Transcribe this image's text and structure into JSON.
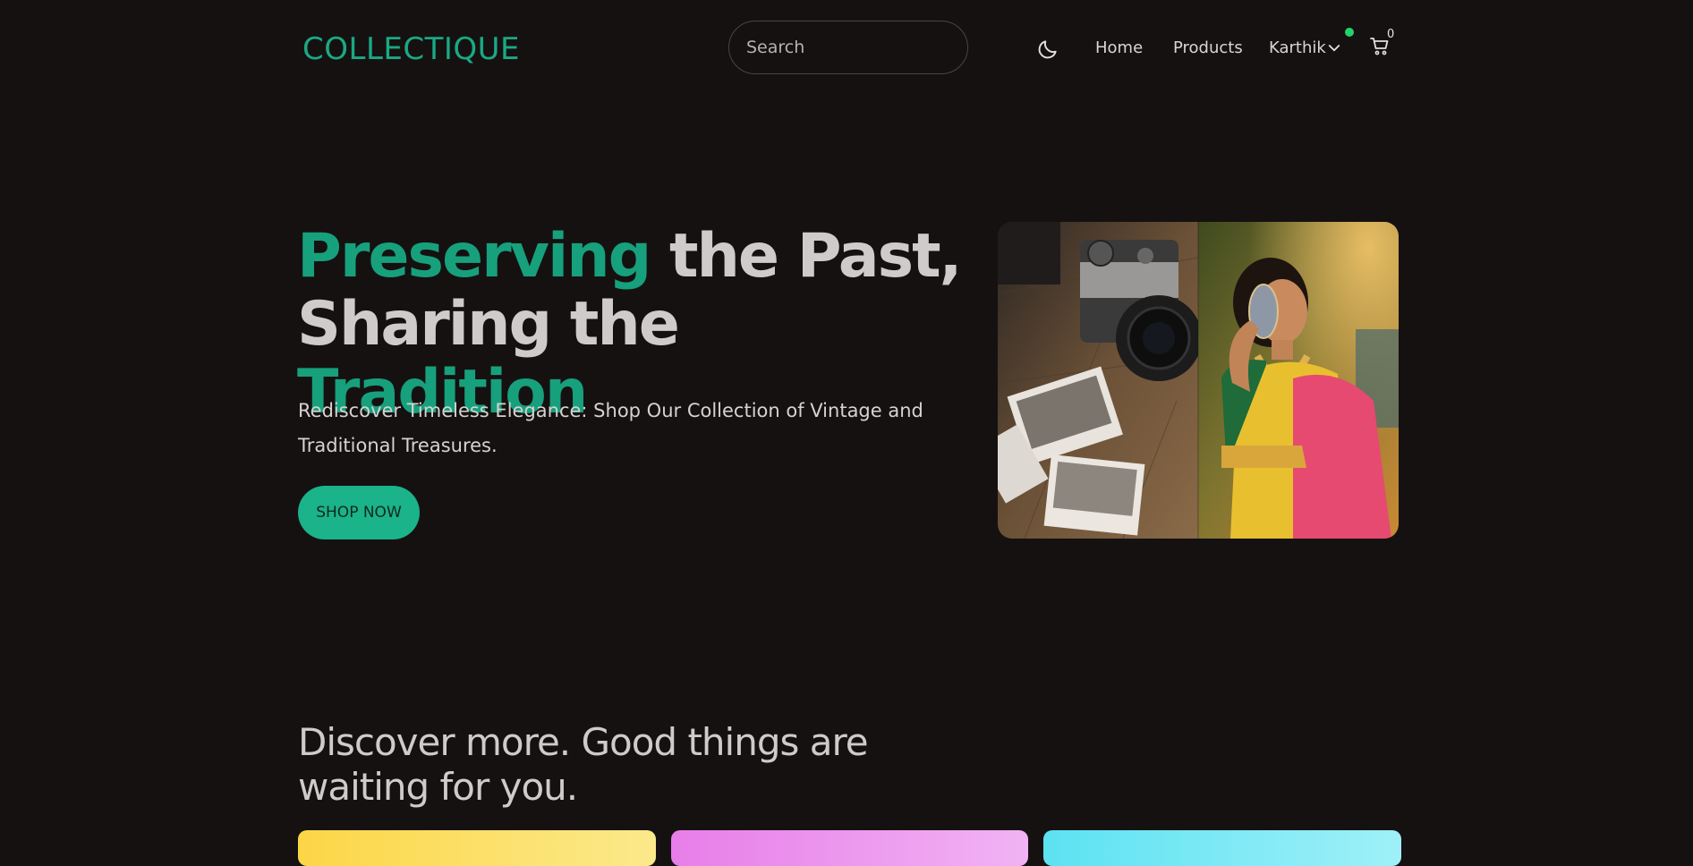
{
  "nav": {
    "brand": "COLLECTIQUE",
    "search_placeholder": "Search",
    "links": [
      "Home",
      "Products"
    ],
    "user_name": "Karthik",
    "cart_count": "0"
  },
  "hero": {
    "title_accent_1": "Preserving",
    "title_mid": " the Past, Sharing the ",
    "title_accent_2": "Tradition",
    "subtitle": "Rediscover Timeless Elegance: Shop Our Collection of Vintage and Traditional Treasures.",
    "cta_label": "SHOP NOW"
  },
  "discover": {
    "title": "Discover more. Good things are waiting for you."
  },
  "colors": {
    "accent": "#1aa984",
    "background": "#151111",
    "status_online": "#22d36a"
  },
  "icons": [
    "moon-icon",
    "chevron-down-icon",
    "cart-icon"
  ]
}
